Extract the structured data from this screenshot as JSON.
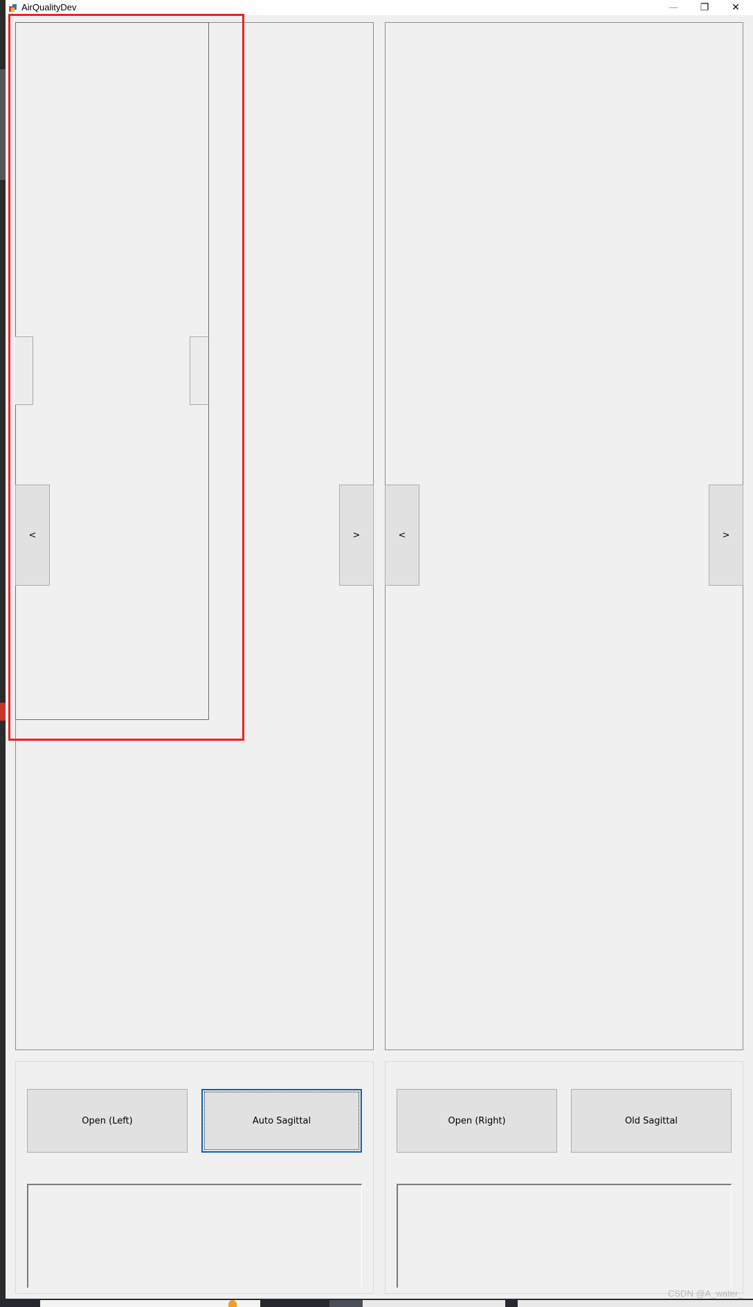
{
  "window": {
    "title": "AirQualityDev",
    "controls": {
      "minimize": "—",
      "restore": "❐",
      "close": "✕"
    }
  },
  "left_panel": {
    "prev_label": "<",
    "next_label": ">"
  },
  "right_panel": {
    "prev_label": "<",
    "next_label": ">"
  },
  "left_controls": {
    "open_label": "Open (Left)",
    "auto_label": "Auto Sagittal",
    "log_text": ""
  },
  "right_controls": {
    "open_label": "Open (Right)",
    "old_label": "Old Sagittal",
    "log_text": ""
  },
  "watermark": "CSDN @A_water_",
  "colors": {
    "highlight": "#e8231f",
    "focus_border": "#0b64c0",
    "button_face": "#e1e1e1",
    "window_bg": "#f0f0f0"
  }
}
